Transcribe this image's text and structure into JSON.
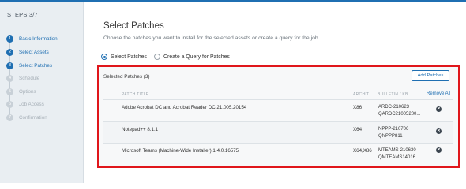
{
  "sidebar": {
    "title": "STEPS 3/7",
    "steps": [
      {
        "num": "1",
        "label": "Basic Information",
        "state": "done"
      },
      {
        "num": "2",
        "label": "Select Assets",
        "state": "done"
      },
      {
        "num": "3",
        "label": "Select Patches",
        "state": "done"
      },
      {
        "num": "4",
        "label": "Schedule",
        "state": "pending"
      },
      {
        "num": "5",
        "label": "Options",
        "state": "pending"
      },
      {
        "num": "6",
        "label": "Job Access",
        "state": "pending"
      },
      {
        "num": "7",
        "label": "Confirmation",
        "state": "pending"
      }
    ]
  },
  "main": {
    "title": "Select Patches",
    "subtitle": "Choose the patches you want to install for the selected assets or create a query for the job.",
    "radio_options": [
      {
        "label": "Select Patches",
        "checked": true
      },
      {
        "label": "Create a Query for Patches",
        "checked": false
      }
    ],
    "selected_count_label": "Selected Patches (3)",
    "add_button_label": "Add Patches",
    "table": {
      "headers": {
        "title": "PATCH TITLE",
        "arch": "ARCHIT",
        "bulletin": "BULLETIN / KB"
      },
      "remove_all_label": "Remove All",
      "rows": [
        {
          "title": "Adobe Acrobat DC and Acrobat Reader DC 21.005.20154",
          "arch": "X86",
          "bulletin": "ARDC-210623",
          "kb": "QARDC21005200..."
        },
        {
          "title": "Notepad++ 8.1.1",
          "arch": "X64",
          "bulletin": "NPPP-210706",
          "kb": "QNPPP811"
        },
        {
          "title": "Microsoft Teams (Machine-Wide Installer) 1.4.0.16575",
          "arch": "X64,X86",
          "bulletin": "MTEAMS-210630",
          "kb": "QMTEAMS14016..."
        }
      ]
    }
  },
  "colors": {
    "accent": "#1f6fb2",
    "highlight": "#e0161b"
  }
}
